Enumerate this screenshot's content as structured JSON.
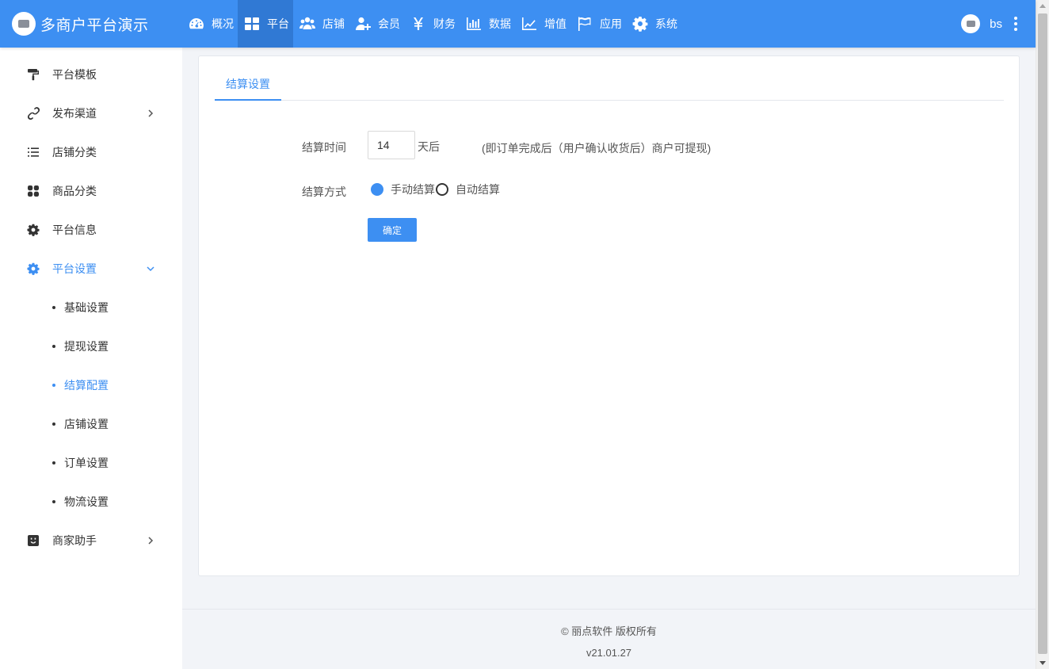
{
  "header": {
    "brand_title": "多商户平台演示",
    "nav": [
      {
        "label": "概况",
        "icon": "dashboard-icon"
      },
      {
        "label": "平台",
        "icon": "grid-icon",
        "active": true
      },
      {
        "label": "店铺",
        "icon": "users-icon"
      },
      {
        "label": "会员",
        "icon": "user-add-icon"
      },
      {
        "label": "财务",
        "icon": "yen-icon"
      },
      {
        "label": "数据",
        "icon": "bar-chart-icon"
      },
      {
        "label": "增值",
        "icon": "line-chart-icon"
      },
      {
        "label": "应用",
        "icon": "flag-icon"
      },
      {
        "label": "系统",
        "icon": "gear-icon"
      }
    ],
    "username": "bs"
  },
  "sidebar": {
    "items": [
      {
        "label": "平台模板",
        "icon": "paint-roller-icon"
      },
      {
        "label": "发布渠道",
        "icon": "link-icon"
      },
      {
        "label": "店铺分类",
        "icon": "list-icon"
      },
      {
        "label": "商品分类",
        "icon": "apps-icon"
      },
      {
        "label": "平台信息",
        "icon": "gear-icon"
      },
      {
        "label": "平台设置",
        "icon": "gear-icon",
        "expanded": true
      },
      {
        "label": "商家助手",
        "icon": "smile-icon"
      }
    ],
    "sub_items": [
      "基础设置",
      "提现设置",
      "结算配置",
      "店铺设置",
      "订单设置",
      "物流设置"
    ],
    "active_sub": "结算配置"
  },
  "main": {
    "tab_label": "结算设置",
    "settle_time_label": "结算时间",
    "settle_days_value": "14",
    "settle_days_unit": "天后",
    "settle_hint": "(即订单完成后（用户确认收货后）商户可提现)",
    "settle_method_label": "结算方式",
    "radio_manual": "手动结算",
    "radio_auto": "自动结算",
    "selected_method": "手动结算",
    "confirm_label": "确定"
  },
  "footer": {
    "copyright": "© 丽点软件 版权所有",
    "version": "v21.01.27"
  },
  "colors": {
    "accent": "#3d8ff2",
    "topbar_active": "#3079d4",
    "background": "#f2f4f8"
  }
}
